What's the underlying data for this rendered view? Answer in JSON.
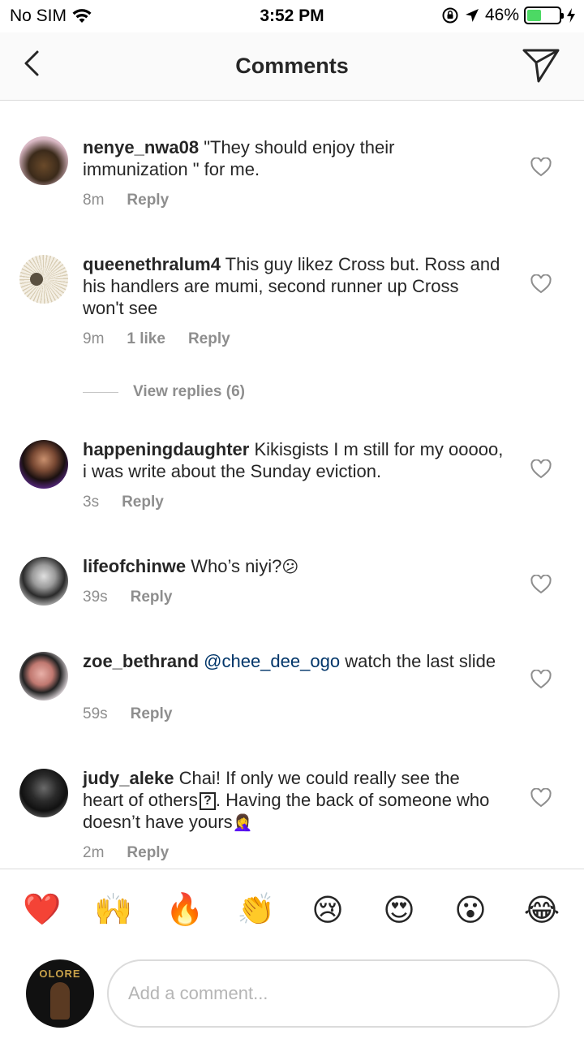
{
  "status_bar": {
    "carrier": "No SIM",
    "time": "3:52 PM",
    "battery": "46%",
    "battery_level": 0.46,
    "battery_color": "#4cd964"
  },
  "nav": {
    "title": "Comments",
    "back_icon": "chevron-left-icon",
    "send_icon": "paper-plane-icon"
  },
  "comments": [
    {
      "username": "nenye_nwa08",
      "text": " \"They should enjoy their immunization \" for me.",
      "time": "8m",
      "likes": "",
      "reply": "Reply"
    },
    {
      "username": "queenethralum4",
      "text": " This guy likez Cross but. Ross and his handlers are mumi, second runner up Cross won't  see",
      "time": "9m",
      "likes": "1 like",
      "reply": "Reply"
    },
    {
      "username": "happeningdaughter",
      "text": " Kikisgists I m still for my ooooo, i was write about the Sunday eviction.",
      "time": "3s",
      "likes": "",
      "reply": "Reply"
    },
    {
      "username": "lifeofchinwe",
      "text": " Who’s niyi?",
      "emoji": "😕",
      "time": "39s",
      "likes": "",
      "reply": "Reply"
    },
    {
      "username": "zoe_bethrand",
      "mention": " @chee_dee_ogo",
      "text": " watch the last slide",
      "time": "59s",
      "likes": "",
      "reply": "Reply"
    },
    {
      "username": "judy_aleke",
      "text": " Chai! If only we could really see the heart of others",
      "emoji_box": "?",
      "text2": ". Having the back of someone who doesn’t have yours",
      "emoji": "🤦‍♀️",
      "time": "2m",
      "likes": "",
      "reply": "Reply"
    }
  ],
  "view_replies": "View replies (6)",
  "emoji_bar": [
    "❤️",
    "🙌",
    "🔥",
    "👏",
    "😢",
    "😍",
    "😮",
    "😂"
  ],
  "composer": {
    "placeholder": "Add a comment...",
    "avatar_text": "OLORE"
  },
  "colors": {
    "mention": "#003569",
    "meta": "#8e8e8e",
    "divider": "#dbdbdb"
  }
}
